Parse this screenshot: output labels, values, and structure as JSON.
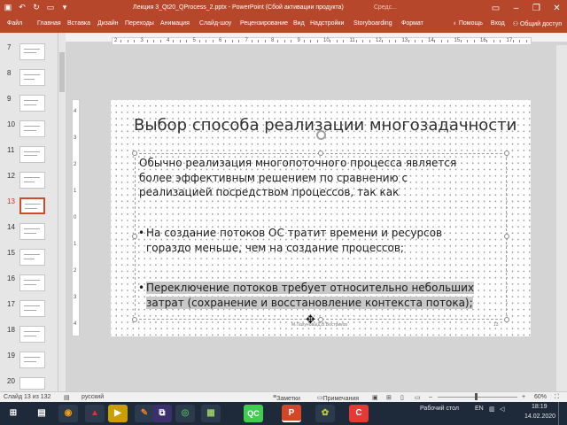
{
  "window": {
    "title": "Лекция 3_Qt20_QProcess_2.pptx - PowerPoint (Сбой активации продукта)",
    "title_suffix": "Средс..."
  },
  "tabs": [
    "Файл",
    "Главная",
    "Вставка",
    "Дизайн",
    "Переходы",
    "Анимация",
    "Слайд-шоу",
    "Рецензирование",
    "Вид",
    "Надстройки",
    "Storyboarding",
    "Формат"
  ],
  "tabs_right": {
    "help": "Помощь",
    "login": "Вход",
    "share": "Общий доступ"
  },
  "thumbnails": {
    "numbers": [
      "7",
      "8",
      "9",
      "10",
      "11",
      "12",
      "13",
      "14",
      "15",
      "16",
      "17",
      "18",
      "19",
      "20"
    ],
    "selected": "13"
  },
  "ruler": {
    "h": [
      "2",
      "3",
      "4",
      "5",
      "6",
      "7",
      "8",
      "9",
      "10",
      "11",
      "12",
      "13",
      "14",
      "15",
      "16",
      "17"
    ],
    "v": [
      "4",
      "3",
      "2",
      "1",
      "0",
      "1",
      "2",
      "3",
      "4"
    ]
  },
  "slide": {
    "title": "Выбор способа реализации многозадачности",
    "para": [
      "Обычно реализация многопоточного процесса является",
      "более эффективным решением по сравнению с",
      "реализацией посредством процессов, так как"
    ],
    "bullet1": [
      "На создание потоков ОС тратит времени и ресурсов",
      "гораздо меньше, чем на создание процессов;"
    ],
    "bullet2": [
      "Переключение потоков требует относительно небольших",
      "затрат (сохранение и восстановление контекста потока);"
    ],
    "bullet_char": "•",
    "footer": "М.Пахунова/Д.В.Востриков",
    "number": "13"
  },
  "status": {
    "slide": "Слайд 13 из 132",
    "lang": "русский",
    "notes": "Заметки",
    "comments": "Примечания",
    "zoom": "60%"
  },
  "taskbar": {
    "desktop": "Рабочий стол",
    "lang": "EN",
    "time": "18:19",
    "date": "14.02.2020"
  }
}
